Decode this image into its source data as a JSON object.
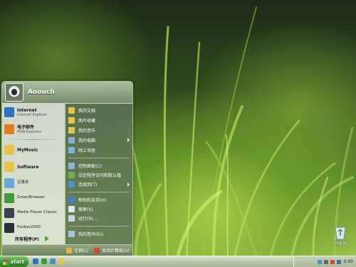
{
  "desktop": {
    "icon_label": "回收站",
    "icon_name": "recycle-bin-icon"
  },
  "start_menu": {
    "user_name": "Aoouch",
    "pinned": [
      {
        "title": "Internet",
        "subtitle": "Internet Explorer",
        "icon": "ie-icon",
        "color": "#2a72c9"
      },
      {
        "title": "电子邮件",
        "subtitle": "MSN Explorer",
        "icon": "msn-icon",
        "color": "#e07b1f"
      }
    ],
    "recent": [
      {
        "title": "MyMusic",
        "icon": "folder-icon",
        "color": "#e8c34a"
      },
      {
        "title": "Software",
        "icon": "folder-icon",
        "color": "#e8c34a"
      },
      {
        "title": "记事本",
        "icon": "notepad-icon",
        "color": "#6aa7d8"
      },
      {
        "title": "GreenBrowser",
        "icon": "greenbrowser-icon",
        "color": "#3e9a3a"
      },
      {
        "title": "Media Player Classic",
        "icon": "media-player-icon",
        "color": "#3a3f4a"
      },
      {
        "title": "Foobar2000",
        "icon": "foobar-icon",
        "color": "#2b2f35"
      }
    ],
    "all_programs": "所有程序(P)",
    "right_items_1": [
      {
        "label": "我的文档",
        "icon": "documents-folder-icon",
        "color": "#e8c34a",
        "submenu": false
      },
      {
        "label": "图片收藏",
        "icon": "pictures-folder-icon",
        "color": "#e8c34a",
        "submenu": false
      },
      {
        "label": "我的音乐",
        "icon": "music-folder-icon",
        "color": "#e8c34a",
        "submenu": false
      },
      {
        "label": "我的电脑",
        "icon": "computer-icon",
        "color": "#7fb3d9",
        "submenu": true
      },
      {
        "label": "网上邻居",
        "icon": "network-icon",
        "color": "#7fb3d9",
        "submenu": false
      }
    ],
    "right_items_2": [
      {
        "label": "控制面板(C)",
        "icon": "control-panel-icon",
        "color": "#8fb5d8",
        "submenu": false
      },
      {
        "label": "设定程序访问和默认值",
        "icon": "program-defaults-icon",
        "color": "#6fae4a",
        "submenu": false
      },
      {
        "label": "连接到(T)",
        "icon": "connect-icon",
        "color": "#4d8fcf",
        "submenu": true
      }
    ],
    "right_items_3": [
      {
        "label": "帮助和支持(H)",
        "icon": "help-icon",
        "color": "#3d7fd0",
        "submenu": false
      },
      {
        "label": "搜索(S)",
        "icon": "search-icon",
        "color": "#dfe7ee",
        "submenu": false
      },
      {
        "label": "运行(R)...",
        "icon": "run-icon",
        "color": "#c9d6e2",
        "submenu": false
      }
    ],
    "right_items_4": [
      {
        "label": "我的悠鸟中心",
        "icon": "user-center-icon",
        "color": "#a9c4dd",
        "submenu": false
      }
    ],
    "logoff": "注销(L)",
    "shutdown": "关闭计算机(U)"
  },
  "taskbar": {
    "start_label": "start",
    "clock": "0:00"
  }
}
